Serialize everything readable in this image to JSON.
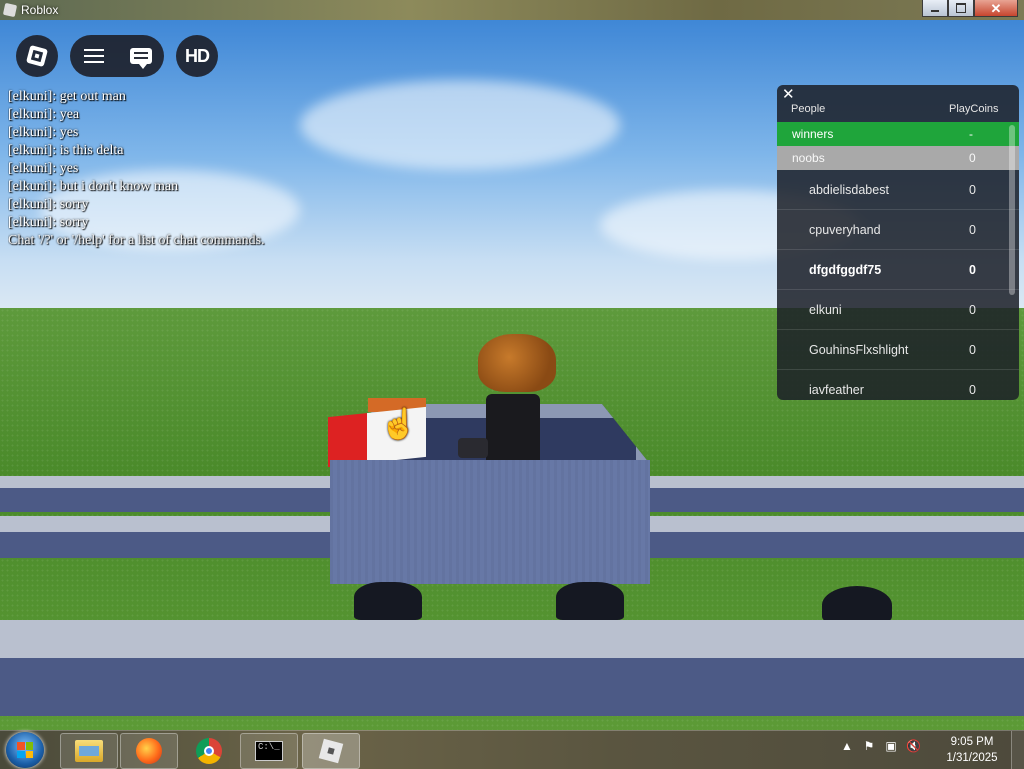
{
  "window": {
    "title": "Roblox",
    "controls": [
      "minimize-icon",
      "maximize-icon",
      "close-icon"
    ]
  },
  "hud": {
    "buttons": [
      "roblox-menu-icon",
      "hamburger-menu-icon",
      "chat-icon"
    ],
    "quality_label": "HD"
  },
  "chat": {
    "messages": [
      {
        "speaker": "[elkuni]:",
        "text": "get out man"
      },
      {
        "speaker": "[elkuni]:",
        "text": "yea"
      },
      {
        "speaker": "[elkuni]:",
        "text": "yes"
      },
      {
        "speaker": "[elkuni]:",
        "text": "is this delta"
      },
      {
        "speaker": "[elkuni]:",
        "text": "yes"
      },
      {
        "speaker": "[elkuni]:",
        "text": "but i don't know man"
      },
      {
        "speaker": "[elkuni]:",
        "text": "sorry"
      },
      {
        "speaker": "[elkuni]:",
        "text": "sorry"
      }
    ],
    "hint": "Chat '/?' or '/help' for a list of chat commands."
  },
  "leaderboard": {
    "col_people": "People",
    "col_stat": "PlayCoins",
    "teams": [
      {
        "name": "winners",
        "value": "-",
        "color": "#1fa53b"
      },
      {
        "name": "noobs",
        "value": "0",
        "color": "#a9a9a9"
      }
    ],
    "players": [
      {
        "name": "abdielisdabest",
        "value": "0"
      },
      {
        "name": "cpuveryhand",
        "value": "0"
      },
      {
        "name": "dfgdfggdf75",
        "value": "0"
      },
      {
        "name": "elkuni",
        "value": "0"
      },
      {
        "name": "GouhinsFlxshlight",
        "value": "0"
      },
      {
        "name": "iavfeather",
        "value": "0"
      }
    ]
  },
  "taskbar": {
    "apps": [
      "windows-explorer-icon",
      "firefox-icon",
      "chrome-icon",
      "command-prompt-icon",
      "roblox-icon"
    ],
    "cmd_glyph": "C:\\_",
    "tray_icons": [
      "show-hidden-icons",
      "action-center-flag-icon",
      "network-icon",
      "volume-muted-icon"
    ],
    "time": "9:05 PM",
    "date": "1/31/2025"
  }
}
